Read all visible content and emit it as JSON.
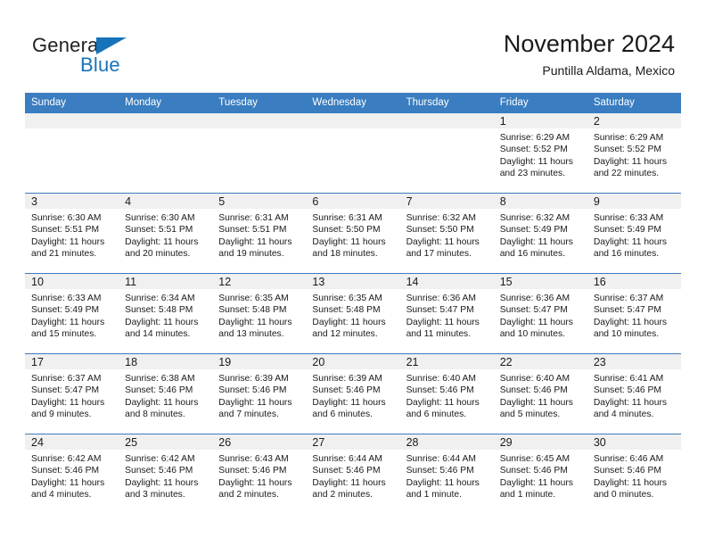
{
  "brand": {
    "name_top": "General",
    "name_bottom": "Blue",
    "accent_color": "#1673bb"
  },
  "header": {
    "title": "November 2024",
    "subtitle": "Puntilla Aldama, Mexico"
  },
  "theme": {
    "header_row_color": "#3a7dc0",
    "daynum_band_color": "#f0f0f0",
    "text_color": "#1a1a1a"
  },
  "weekdays": [
    "Sunday",
    "Monday",
    "Tuesday",
    "Wednesday",
    "Thursday",
    "Friday",
    "Saturday"
  ],
  "weeks": [
    [
      {
        "day": "",
        "empty": true
      },
      {
        "day": "",
        "empty": true
      },
      {
        "day": "",
        "empty": true
      },
      {
        "day": "",
        "empty": true
      },
      {
        "day": "",
        "empty": true
      },
      {
        "day": "1",
        "sunrise": "Sunrise: 6:29 AM",
        "sunset": "Sunset: 5:52 PM",
        "daylight1": "Daylight: 11 hours",
        "daylight2": "and 23 minutes."
      },
      {
        "day": "2",
        "sunrise": "Sunrise: 6:29 AM",
        "sunset": "Sunset: 5:52 PM",
        "daylight1": "Daylight: 11 hours",
        "daylight2": "and 22 minutes."
      }
    ],
    [
      {
        "day": "3",
        "sunrise": "Sunrise: 6:30 AM",
        "sunset": "Sunset: 5:51 PM",
        "daylight1": "Daylight: 11 hours",
        "daylight2": "and 21 minutes."
      },
      {
        "day": "4",
        "sunrise": "Sunrise: 6:30 AM",
        "sunset": "Sunset: 5:51 PM",
        "daylight1": "Daylight: 11 hours",
        "daylight2": "and 20 minutes."
      },
      {
        "day": "5",
        "sunrise": "Sunrise: 6:31 AM",
        "sunset": "Sunset: 5:51 PM",
        "daylight1": "Daylight: 11 hours",
        "daylight2": "and 19 minutes."
      },
      {
        "day": "6",
        "sunrise": "Sunrise: 6:31 AM",
        "sunset": "Sunset: 5:50 PM",
        "daylight1": "Daylight: 11 hours",
        "daylight2": "and 18 minutes."
      },
      {
        "day": "7",
        "sunrise": "Sunrise: 6:32 AM",
        "sunset": "Sunset: 5:50 PM",
        "daylight1": "Daylight: 11 hours",
        "daylight2": "and 17 minutes."
      },
      {
        "day": "8",
        "sunrise": "Sunrise: 6:32 AM",
        "sunset": "Sunset: 5:49 PM",
        "daylight1": "Daylight: 11 hours",
        "daylight2": "and 16 minutes."
      },
      {
        "day": "9",
        "sunrise": "Sunrise: 6:33 AM",
        "sunset": "Sunset: 5:49 PM",
        "daylight1": "Daylight: 11 hours",
        "daylight2": "and 16 minutes."
      }
    ],
    [
      {
        "day": "10",
        "sunrise": "Sunrise: 6:33 AM",
        "sunset": "Sunset: 5:49 PM",
        "daylight1": "Daylight: 11 hours",
        "daylight2": "and 15 minutes."
      },
      {
        "day": "11",
        "sunrise": "Sunrise: 6:34 AM",
        "sunset": "Sunset: 5:48 PM",
        "daylight1": "Daylight: 11 hours",
        "daylight2": "and 14 minutes."
      },
      {
        "day": "12",
        "sunrise": "Sunrise: 6:35 AM",
        "sunset": "Sunset: 5:48 PM",
        "daylight1": "Daylight: 11 hours",
        "daylight2": "and 13 minutes."
      },
      {
        "day": "13",
        "sunrise": "Sunrise: 6:35 AM",
        "sunset": "Sunset: 5:48 PM",
        "daylight1": "Daylight: 11 hours",
        "daylight2": "and 12 minutes."
      },
      {
        "day": "14",
        "sunrise": "Sunrise: 6:36 AM",
        "sunset": "Sunset: 5:47 PM",
        "daylight1": "Daylight: 11 hours",
        "daylight2": "and 11 minutes."
      },
      {
        "day": "15",
        "sunrise": "Sunrise: 6:36 AM",
        "sunset": "Sunset: 5:47 PM",
        "daylight1": "Daylight: 11 hours",
        "daylight2": "and 10 minutes."
      },
      {
        "day": "16",
        "sunrise": "Sunrise: 6:37 AM",
        "sunset": "Sunset: 5:47 PM",
        "daylight1": "Daylight: 11 hours",
        "daylight2": "and 10 minutes."
      }
    ],
    [
      {
        "day": "17",
        "sunrise": "Sunrise: 6:37 AM",
        "sunset": "Sunset: 5:47 PM",
        "daylight1": "Daylight: 11 hours",
        "daylight2": "and 9 minutes."
      },
      {
        "day": "18",
        "sunrise": "Sunrise: 6:38 AM",
        "sunset": "Sunset: 5:46 PM",
        "daylight1": "Daylight: 11 hours",
        "daylight2": "and 8 minutes."
      },
      {
        "day": "19",
        "sunrise": "Sunrise: 6:39 AM",
        "sunset": "Sunset: 5:46 PM",
        "daylight1": "Daylight: 11 hours",
        "daylight2": "and 7 minutes."
      },
      {
        "day": "20",
        "sunrise": "Sunrise: 6:39 AM",
        "sunset": "Sunset: 5:46 PM",
        "daylight1": "Daylight: 11 hours",
        "daylight2": "and 6 minutes."
      },
      {
        "day": "21",
        "sunrise": "Sunrise: 6:40 AM",
        "sunset": "Sunset: 5:46 PM",
        "daylight1": "Daylight: 11 hours",
        "daylight2": "and 6 minutes."
      },
      {
        "day": "22",
        "sunrise": "Sunrise: 6:40 AM",
        "sunset": "Sunset: 5:46 PM",
        "daylight1": "Daylight: 11 hours",
        "daylight2": "and 5 minutes."
      },
      {
        "day": "23",
        "sunrise": "Sunrise: 6:41 AM",
        "sunset": "Sunset: 5:46 PM",
        "daylight1": "Daylight: 11 hours",
        "daylight2": "and 4 minutes."
      }
    ],
    [
      {
        "day": "24",
        "sunrise": "Sunrise: 6:42 AM",
        "sunset": "Sunset: 5:46 PM",
        "daylight1": "Daylight: 11 hours",
        "daylight2": "and 4 minutes."
      },
      {
        "day": "25",
        "sunrise": "Sunrise: 6:42 AM",
        "sunset": "Sunset: 5:46 PM",
        "daylight1": "Daylight: 11 hours",
        "daylight2": "and 3 minutes."
      },
      {
        "day": "26",
        "sunrise": "Sunrise: 6:43 AM",
        "sunset": "Sunset: 5:46 PM",
        "daylight1": "Daylight: 11 hours",
        "daylight2": "and 2 minutes."
      },
      {
        "day": "27",
        "sunrise": "Sunrise: 6:44 AM",
        "sunset": "Sunset: 5:46 PM",
        "daylight1": "Daylight: 11 hours",
        "daylight2": "and 2 minutes."
      },
      {
        "day": "28",
        "sunrise": "Sunrise: 6:44 AM",
        "sunset": "Sunset: 5:46 PM",
        "daylight1": "Daylight: 11 hours",
        "daylight2": "and 1 minute."
      },
      {
        "day": "29",
        "sunrise": "Sunrise: 6:45 AM",
        "sunset": "Sunset: 5:46 PM",
        "daylight1": "Daylight: 11 hours",
        "daylight2": "and 1 minute."
      },
      {
        "day": "30",
        "sunrise": "Sunrise: 6:46 AM",
        "sunset": "Sunset: 5:46 PM",
        "daylight1": "Daylight: 11 hours",
        "daylight2": "and 0 minutes."
      }
    ]
  ]
}
